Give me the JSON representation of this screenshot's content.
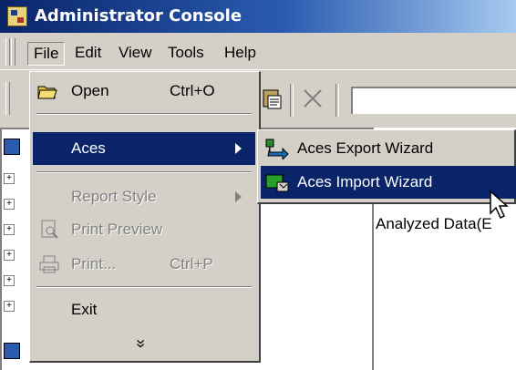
{
  "window": {
    "title": "Administrator Console"
  },
  "menubar": {
    "items": [
      {
        "label": "File"
      },
      {
        "label": "Edit"
      },
      {
        "label": "View"
      },
      {
        "label": "Tools"
      },
      {
        "label": "Help"
      }
    ]
  },
  "file_menu": {
    "items": [
      {
        "label": "Open",
        "shortcut": "Ctrl+O",
        "icon": "open-folder-icon",
        "enabled": true
      },
      {
        "label": "Aces",
        "submenu": true,
        "enabled": true,
        "highlighted": true
      },
      {
        "label": "Report Style",
        "submenu": true,
        "enabled": false
      },
      {
        "label": "Print Preview",
        "icon": "print-preview-icon",
        "enabled": false
      },
      {
        "label": "Print...",
        "shortcut": "Ctrl+P",
        "icon": "printer-icon",
        "enabled": false
      },
      {
        "label": "Exit",
        "enabled": true
      }
    ],
    "more_glyph": "»"
  },
  "aces_submenu": {
    "items": [
      {
        "label": "Aces Export Wizard",
        "icon": "export-wizard-icon"
      },
      {
        "label": "Aces Import Wizard",
        "icon": "import-wizard-icon",
        "highlighted": true
      }
    ]
  },
  "right_pane": {
    "column_label": "Analyzed Data(E"
  },
  "colors": {
    "highlight": "#0a246a",
    "face": "#d4d0c8",
    "disabled_text": "#808080"
  }
}
